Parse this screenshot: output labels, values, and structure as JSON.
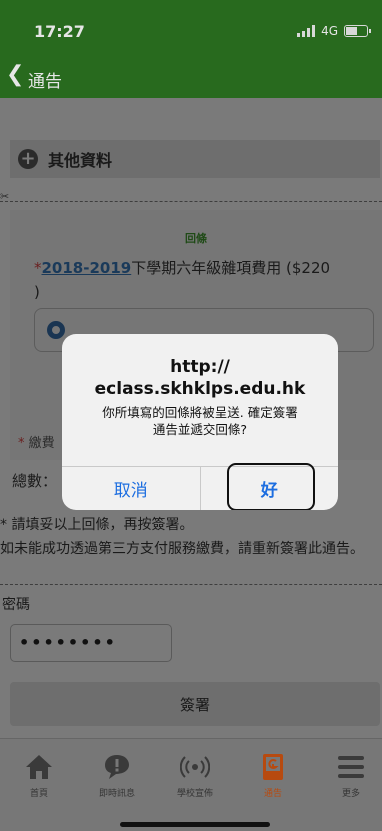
{
  "status_bar": {
    "time": "17:27",
    "network": "4G"
  },
  "nav": {
    "back_icon": "chevron-left-icon",
    "title": "通告"
  },
  "section": {
    "icon": "plus-circle-icon",
    "title": "其他資料"
  },
  "reply_slip": {
    "scissors_icon": "scissors-icon",
    "scissors_glyph": "✂",
    "title": "回條",
    "item": {
      "star": "*",
      "year": "2018-2019",
      "text": "下學期六年級雜項費用 ($220",
      "close": ")"
    }
  },
  "form": {
    "fee_label_star": "* ",
    "fee_label": "繳費",
    "total_label": "總數：",
    "note1": "* 請填妥以上回條，再按簽署。",
    "note2": "如未能成功透過第三方支付服務繳費，請重新簽署此通告。",
    "password_label": "密碼",
    "password_value": "••••••••",
    "sign_button": "簽署"
  },
  "dialog": {
    "title_line1": "http://",
    "title_line2": "eclass.skhklps.edu.hk",
    "message_line1": "你所填寫的回條將被呈送. 確定簽署",
    "message_line2": "通告並遞交回條?",
    "cancel": "取消",
    "ok": "好"
  },
  "tabs": [
    {
      "icon": "home-icon",
      "label": "首頁"
    },
    {
      "icon": "chat-bubble-icon",
      "label": "即時訊息"
    },
    {
      "icon": "broadcast-icon",
      "label": "學校宣佈"
    },
    {
      "icon": "notice-icon",
      "label": "通告",
      "active": true
    },
    {
      "icon": "menu-icon",
      "label": "更多"
    }
  ],
  "colors": {
    "brand_green": "#286a1e",
    "active_tab": "#b74a0f",
    "dialog_button": "#1d6ee0"
  }
}
